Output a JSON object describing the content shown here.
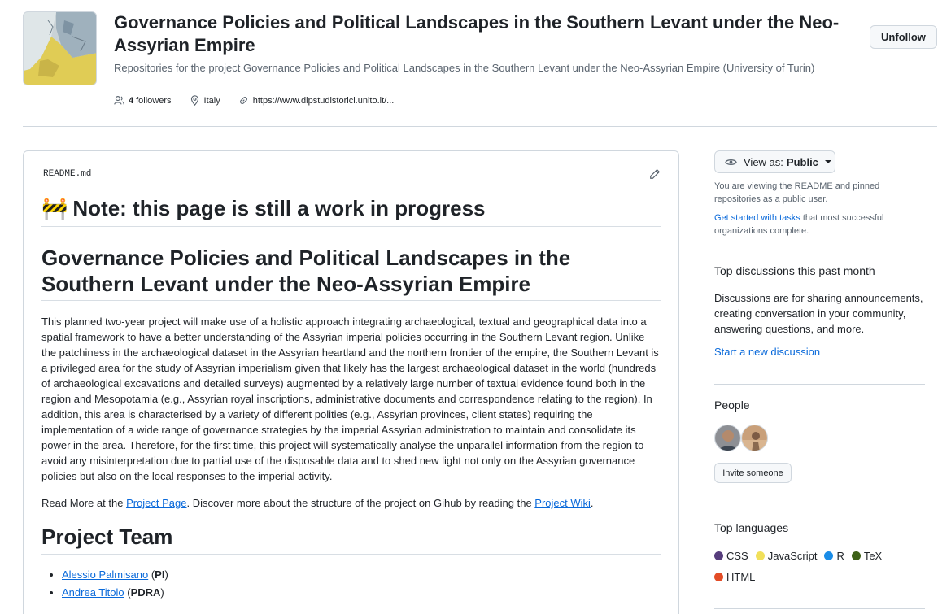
{
  "header": {
    "title": "Governance Policies and Political Landscapes in the Southern Levant under the Neo-Assyrian Empire",
    "description": "Repositories for the project Governance Policies and Political Landscapes in the Southern Levant under the Neo-Assyrian Empire (University of Turin)",
    "followers_count": "4",
    "followers_label": "followers",
    "location": "Italy",
    "website": "https://www.dipstudistorici.unito.it/...",
    "unfollow_label": "Unfollow"
  },
  "readme": {
    "filename": "README.md",
    "note_emoji": "🚧",
    "note_heading": "Note: this page is still a work in progress",
    "main_heading": "Governance Policies and Political Landscapes in the Southern Levant under the Neo-Assyrian Empire",
    "paragraph": "This planned two-year project will make use of a holistic approach integrating archaeological, textual and geographical data into a spatial framework to have a better understanding of the Assyrian imperial policies occurring in the Southern Levant region. Unlike the patchiness in the archaeological dataset in the Assyrian heartland and the northern frontier of the empire, the Southern Levant is a privileged area for the study of Assyrian imperialism given that likely has the largest archaeological dataset in the world (hundreds of archaeological excavations and detailed surveys) augmented by a relatively large number of textual evidence found both in the region and Mesopotamia (e.g., Assyrian royal inscriptions, administrative documents and correspondence relating to the region). In addition, this area is characterised by a variety of different polities (e.g., Assyrian provinces, client states) requiring the implementation of a wide range of governance strategies by the imperial Assyrian administration to maintain and consolidate its power in the area. Therefore, for the first time, this project will systematically analyse the unparallel information from the region to avoid any misinterpretation due to partial use of the disposable data and to shed new light not only on the Assyrian governance policies but also on the local responses to the imperial activity.",
    "read_more_prefix": "Read More at the ",
    "project_page_link": "Project Page",
    "read_more_middle": ". Discover more about the structure of the project on Gihub by reading the ",
    "project_wiki_link": "Project Wiki",
    "read_more_suffix": ".",
    "team_heading": "Project Team",
    "team": [
      {
        "name": "Alessio Palmisano",
        "role": "PI"
      },
      {
        "name": "Andrea Titolo",
        "role": "PDRA"
      }
    ]
  },
  "sidebar": {
    "view_as_prefix": "View as:",
    "view_as_value": "Public",
    "view_note": "You are viewing the README and pinned repositories as a public user.",
    "tasks_link": "Get started with tasks",
    "tasks_rest": " that most successful organizations complete.",
    "discussions_heading": "Top discussions this past month",
    "discussions_text": "Discussions are for sharing announcements, creating conversation in your community, answering questions, and more.",
    "start_discussion": "Start a new discussion",
    "people_heading": "People",
    "invite_label": "Invite someone",
    "languages_heading": "Top languages",
    "languages": [
      {
        "name": "CSS",
        "color": "#563d7c"
      },
      {
        "name": "JavaScript",
        "color": "#f1e05a"
      },
      {
        "name": "R",
        "color": "#198ce7"
      },
      {
        "name": "TeX",
        "color": "#3d6117"
      },
      {
        "name": "HTML",
        "color": "#e34c26"
      }
    ]
  }
}
